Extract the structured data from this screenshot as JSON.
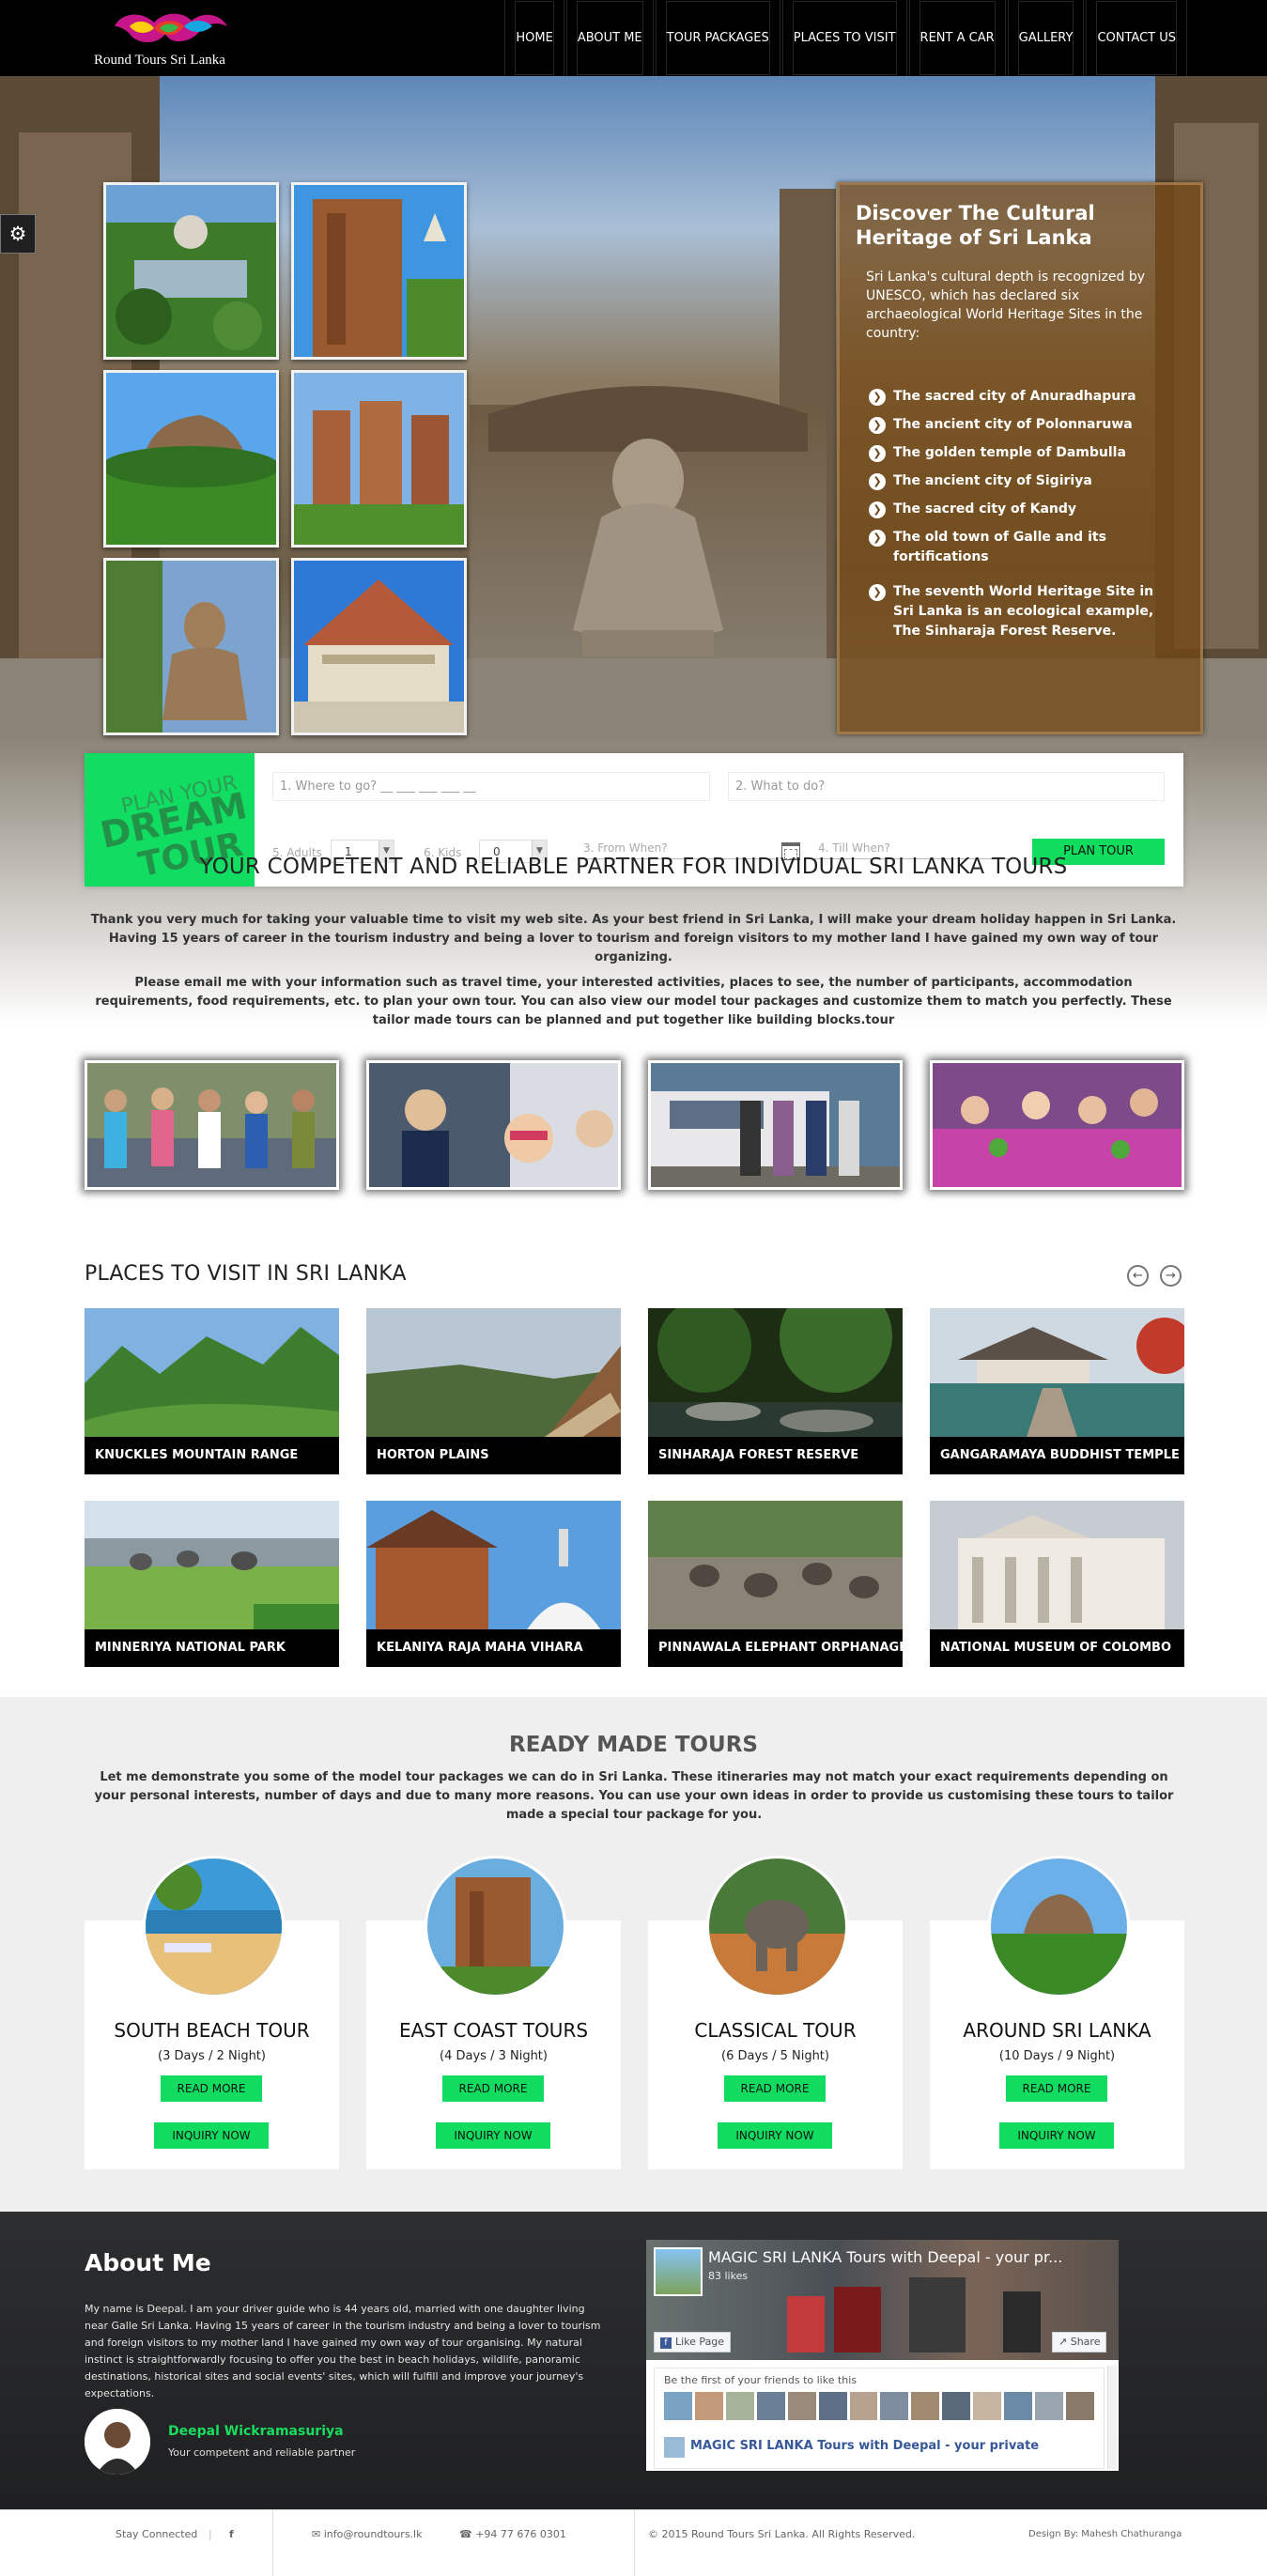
{
  "brand": {
    "name": "Round Tours Sri Lanka"
  },
  "nav": {
    "items": [
      "HOME",
      "ABOUT ME",
      "TOUR PACKAGES",
      "PLACES TO VISIT",
      "RENT A CAR",
      "GALLERY",
      "CONTACT US"
    ]
  },
  "hero": {
    "title": "Discover The Cultural Heritage of Sri Lanka",
    "intro": "Sri Lanka's cultural depth is recognized by UNESCO, which has declared six archaeological World Heritage Sites in the country:",
    "sites": [
      "The sacred city of Anuradhapura",
      "The ancient city of Polonnaruwa",
      "The golden temple of Dambulla",
      "The ancient city of Sigiriya",
      "The sacred city of Kandy",
      "The old town of Galle and its fortifications",
      "The seventh World Heritage Site in Sri Lanka is an ecological example, The Sinharaja Forest Reserve."
    ]
  },
  "planner": {
    "badge": [
      "PLAN YOUR",
      "DREAM",
      "TOUR"
    ],
    "where_placeholder": "1. Where to go? __ ___ ___ ___ __",
    "what_placeholder": "2. What to do?",
    "adults_label": "5. Adults",
    "adults_value": "1",
    "kids_label": "6. Kids",
    "kids_value": "0",
    "from_placeholder": "3. From When?",
    "till_placeholder": "4. Till When?",
    "button": "PLAN TOUR"
  },
  "intro": {
    "heading": "YOUR COMPETENT AND RELIABLE PARTNER FOR INDIVIDUAL SRI LANKA TOURS",
    "p1": "Thank you very much for taking your valuable time to visit my web site. As your best friend in Sri Lanka, I will make your dream holiday happen in Sri Lanka. Having 15 years of career in the tourism industry and being a lover to tourism and foreign visitors to my mother land I have gained my own way of tour organizing.",
    "p2": "Please email me with your information such as travel time, your interested activities, places to see, the number of participants, accommodation requirements, food requirements, etc. to plan your own tour. You can also view our model tour packages and customize them to match you perfectly. These tailor made tours can be planned and put together like building blocks.tour"
  },
  "places": {
    "title": "PLACES TO VISIT IN SRI LANKA",
    "items": [
      "KNUCKLES MOUNTAIN RANGE",
      "HORTON PLAINS",
      "SINHARAJA FOREST RESERVE",
      "GANGARAMAYA BUDDHIST TEMPLE",
      "MINNERIYA NATIONAL PARK",
      "KELANIYA RAJA MAHA VIHARA",
      "PINNAWALA ELEPHANT ORPHANAGE",
      "NATIONAL MUSEUM OF COLOMBO"
    ]
  },
  "tours": {
    "heading": "READY MADE TOURS",
    "text": "Let me demonstrate you some of the model tour packages we can do in Sri Lanka. These itineraries may not match your exact requirements depending on your personal interests, number of days and due to many more reasons. You can use your own ideas in order to provide us customising these tours to tailor made a special tour package for you.",
    "read_more": "READ MORE",
    "inquiry": "INQUIRY NOW",
    "items": [
      {
        "name": "SOUTH BEACH TOUR",
        "days": "(3 Days / 2 Night)"
      },
      {
        "name": "EAST COAST TOURS",
        "days": "(4 Days / 3 Night)"
      },
      {
        "name": "CLASSICAL TOUR",
        "days": "(6 Days / 5 Night)"
      },
      {
        "name": "AROUND SRI LANKA",
        "days": "(10 Days / 9 Night)"
      }
    ]
  },
  "about": {
    "heading": "About Me",
    "bio": "My name is Deepal. I am your driver guide who is 44 years old, married with one daughter living near Galle Sri Lanka. Having 15 years of career in the tourism industry and being a lover to tourism and foreign visitors to my mother land I have gained my own way of tour organising. My natural instinct is straightforwardly focusing to offer you the best in beach holidays, wildlife, panoramic destinations, historical sites and social events' sites, which will fulfill and improve your journey's expectations.",
    "name": "Deepal Wickramasuriya",
    "tagline": "Your competent and reliable partner"
  },
  "facebook": {
    "title": "MAGIC SRI LANKA Tours with Deepal - your pr...",
    "likes": "83 likes",
    "like_btn": "Like Page",
    "share_btn": "Share",
    "friends_text": "Be the first of your friends to like this",
    "post_title": "MAGIC SRI LANKA Tours with Deepal - your private"
  },
  "footer": {
    "stay": "Stay Connected",
    "fb": "f",
    "email": "info@roundtours.lk",
    "phone": "+94 77 676 0301",
    "copyright": "© 2015 Round Tours Sri Lanka. All Rights Reserved.",
    "design": "Design By: Mahesh Chathuranga"
  },
  "colors": {
    "accent": "#12dd63",
    "nav": "#000000",
    "overlay": "#744813"
  }
}
